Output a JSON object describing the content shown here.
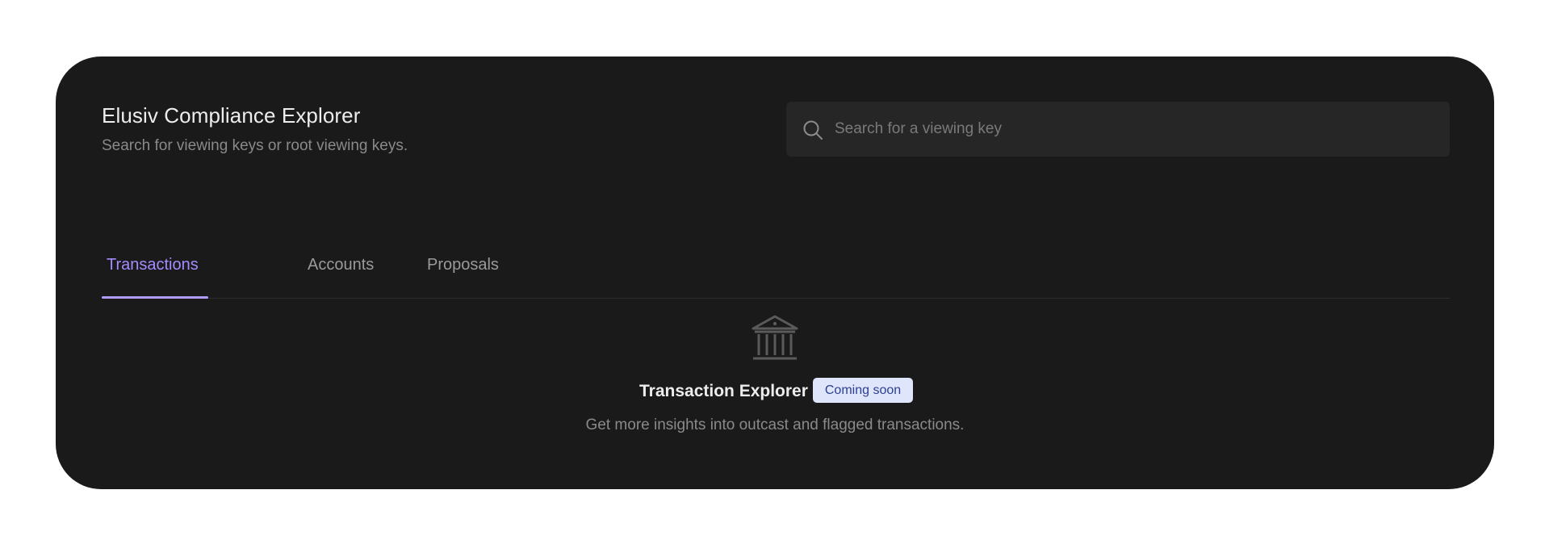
{
  "header": {
    "title": "Elusiv Compliance Explorer",
    "subtitle": "Search for viewing keys or root viewing keys."
  },
  "search": {
    "placeholder": "Search for a viewing key",
    "value": "",
    "icon": "search-icon"
  },
  "tabs": [
    {
      "label": "Transactions",
      "active": true
    },
    {
      "label": "Accounts",
      "active": false
    },
    {
      "label": "Proposals",
      "active": false
    }
  ],
  "empty_state": {
    "icon": "bank-icon",
    "title": "Transaction Explorer",
    "badge": "Coming soon",
    "description": "Get more insights into outcast and flagged transactions."
  },
  "colors": {
    "card_background": "#1a1a1a",
    "accent": "#a58bff",
    "badge_background": "#dfe6fb",
    "badge_text": "#2c3f91"
  }
}
